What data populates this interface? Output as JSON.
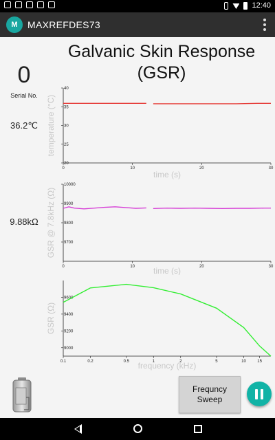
{
  "status_bar": {
    "time": "12:40"
  },
  "app_bar": {
    "logo_text": "M",
    "title": "MAXREFDES73"
  },
  "page": {
    "title_line1": "Galvanic Skin Response",
    "title_line2": "(GSR)"
  },
  "readings": {
    "serial_value": "0",
    "serial_label": "Serial No.",
    "temperature": "36.2℃",
    "gsr": "9.88kΩ"
  },
  "controls": {
    "sweep_label": "Frequncy\nSweep"
  },
  "colors": {
    "temperature": "#e53935",
    "gsr": "#d63fd6",
    "sweep": "#33ee33",
    "accent": "#11b3a6"
  },
  "icons": {
    "battery": "battery-icon",
    "pause": "pause-icon",
    "overflow": "more-vert-icon"
  },
  "chart_data": [
    {
      "type": "line",
      "xlabel": "time (s)",
      "ylabel": "temperature (°C)",
      "xlim": [
        0,
        30
      ],
      "ylim": [
        20,
        40
      ],
      "xticks": [
        0,
        10,
        20,
        30
      ],
      "yticks": [
        20,
        25,
        30,
        35,
        40
      ],
      "series": [
        {
          "color": "#e53935",
          "segments": [
            [
              [
                0,
                35.9
              ],
              [
                3,
                35.9
              ],
              [
                6,
                35.9
              ],
              [
                9,
                35.9
              ],
              [
                12,
                35.9
              ]
            ],
            [
              [
                13,
                35.8
              ],
              [
                16,
                35.8
              ],
              [
                19,
                35.8
              ],
              [
                22,
                35.8
              ],
              [
                25,
                35.8
              ],
              [
                28,
                35.9
              ],
              [
                30,
                35.9
              ]
            ]
          ]
        }
      ]
    },
    {
      "type": "line",
      "xlabel": "time (s)",
      "ylabel": "GSR @ 7.8kHz (Ω)",
      "xlim": [
        0,
        30
      ],
      "ylim": [
        9600,
        10000
      ],
      "xticks": [
        0,
        10,
        20,
        30
      ],
      "yticks": [
        9700,
        9800,
        9900,
        10000
      ],
      "series": [
        {
          "color": "#d63fd6",
          "segments": [
            [
              [
                0,
                9875
              ],
              [
                0.8,
                9883
              ],
              [
                1.6,
                9876
              ],
              [
                3,
                9872
              ],
              [
                4.5,
                9876
              ],
              [
                6,
                9880
              ],
              [
                7.5,
                9883
              ],
              [
                9,
                9879
              ],
              [
                10.5,
                9875
              ],
              [
                12,
                9877
              ]
            ],
            [
              [
                13,
                9874
              ],
              [
                15,
                9876
              ],
              [
                17,
                9875
              ],
              [
                19,
                9876
              ],
              [
                21,
                9875
              ],
              [
                23,
                9874
              ],
              [
                25,
                9875
              ],
              [
                27,
                9875
              ],
              [
                29,
                9876
              ],
              [
                30,
                9876
              ]
            ]
          ]
        }
      ]
    },
    {
      "type": "line",
      "xlabel": "frequency (kHz)",
      "ylabel": "GSR (Ω)",
      "xscale": "log",
      "xlim": [
        0.1,
        20
      ],
      "ylim": [
        8900,
        9800
      ],
      "xticks": [
        0.1,
        0.2,
        0.5,
        1,
        2,
        5,
        10,
        15
      ],
      "xtick_labels": [
        "0.1",
        "0.2",
        "0.5",
        "1",
        "2",
        "5",
        "10",
        "15"
      ],
      "yticks": [
        9000,
        9200,
        9400,
        9600
      ],
      "series": [
        {
          "color": "#33ee33",
          "segments": [
            [
              [
                0.1,
                9540
              ],
              [
                0.2,
                9712
              ],
              [
                0.5,
                9754
              ],
              [
                1,
                9715
              ],
              [
                2,
                9640
              ],
              [
                5,
                9470
              ],
              [
                10,
                9240
              ],
              [
                15,
                9020
              ],
              [
                20,
                8900
              ]
            ]
          ]
        }
      ]
    }
  ]
}
